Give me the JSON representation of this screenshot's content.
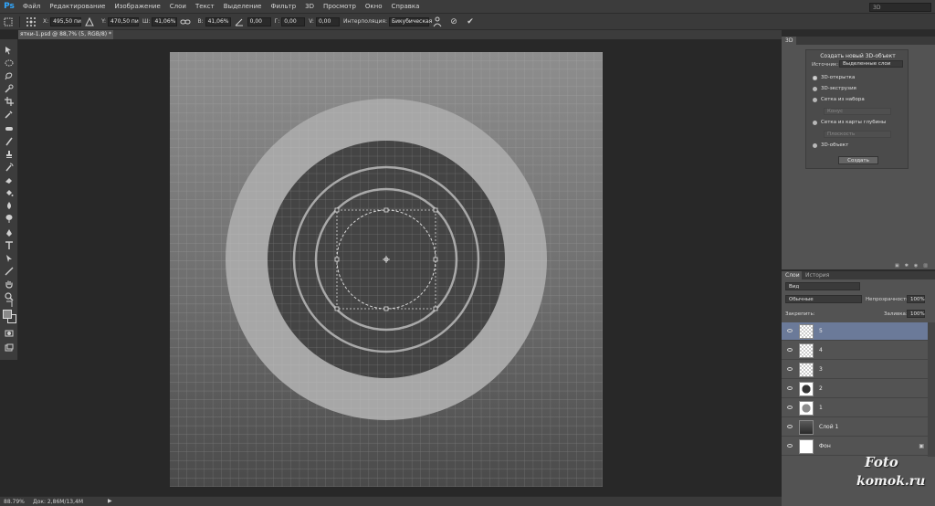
{
  "app": {
    "logo": "Ps"
  },
  "menu": [
    "Файл",
    "Редактирование",
    "Изображение",
    "Слои",
    "Текст",
    "Выделение",
    "Фильтр",
    "3D",
    "Просмотр",
    "Окно",
    "Справка"
  ],
  "workspace": "3D",
  "options": {
    "x_label": "X:",
    "x_value": "495,50 пи",
    "y_label": "Y:",
    "y_value": "470,50 пи",
    "w_label": "Ш:",
    "w_value": "41,06%",
    "h_label": "В:",
    "h_value": "41,06%",
    "angle_value": "0,00",
    "hskew_label": "Г:",
    "hskew_value": "0,00",
    "vskew_label": "V:",
    "vskew_value": "0,00",
    "interp_label": "Интерполяция:",
    "interp_value": "Бикубическая",
    "cancel_glyph": "⊘",
    "commit_glyph": "✔"
  },
  "document_tab": "ятки-1.psd @ 88,7% (5, RGB/8) *",
  "status": {
    "zoom": "88.79%",
    "doc": "Док: 2,86M/13,4M",
    "arrow": "▶"
  },
  "panel3d": {
    "tab": "3D",
    "title": "Создать новый 3D-объект",
    "source_label": "Источник:",
    "source_value": "Выделенные слои",
    "options": [
      "3D-открытка",
      "3D-экструзия",
      "Сетка из набора",
      "Сетка из карты глубины",
      "3D-объект"
    ],
    "preset_value": "Конус",
    "depth_value": "Плоскость",
    "create_button": "Создать"
  },
  "layers_panel": {
    "tabs": [
      "Слои",
      "История"
    ],
    "kind": "Вид",
    "blend": "Обычные",
    "opacity_label": "Непрозрачность:",
    "opacity_value": "100%",
    "lock_label": "Закрепить:",
    "fill_label": "Заливка:",
    "fill_value": "100%",
    "layers": [
      {
        "name": "5",
        "thumb": "check",
        "selected": true
      },
      {
        "name": "4",
        "thumb": "check",
        "selected": false
      },
      {
        "name": "3",
        "thumb": "check",
        "selected": false
      },
      {
        "name": "2",
        "thumb": "dark",
        "selected": false
      },
      {
        "name": "1",
        "thumb": "light",
        "selected": false
      },
      {
        "name": "Слой 1",
        "thumb": "grad",
        "selected": false
      },
      {
        "name": "Фон",
        "thumb": "white",
        "selected": false,
        "locked": true
      }
    ]
  },
  "watermark": {
    "line1": "Foto",
    "line2": "komok.ru"
  },
  "colors": {
    "selection_blue": "#6b7a99",
    "panel": "#535353",
    "accent": "#31a8ff"
  }
}
